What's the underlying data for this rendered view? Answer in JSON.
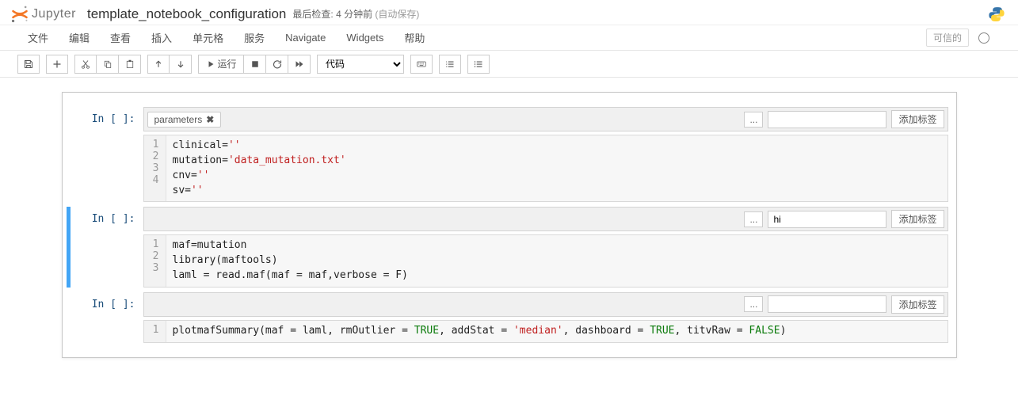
{
  "header": {
    "logo_text": "Jupyter",
    "notebook_name": "template_notebook_configuration",
    "checkpoint_label": "最后检查:",
    "checkpoint_value": "4 分钟前",
    "autosave": "(自动保存)"
  },
  "menubar": {
    "items": [
      "文件",
      "编辑",
      "查看",
      "插入",
      "单元格",
      "服务",
      "Navigate",
      "Widgets",
      "帮助"
    ],
    "trusted": "可信的"
  },
  "toolbar": {
    "run_label": "运行",
    "celltype_value": "代码"
  },
  "tags": {
    "ellipsis": "...",
    "add_button": "添加标签"
  },
  "cells": [
    {
      "prompt": "In [ ]:",
      "tag": "parameters",
      "tag_input": "",
      "lines": [
        {
          "n": "1",
          "pre": "clinical=",
          "str": "''",
          "post": ""
        },
        {
          "n": "2",
          "pre": "mutation=",
          "str": "'data_mutation.txt'",
          "post": ""
        },
        {
          "n": "3",
          "pre": "cnv=",
          "str": "''",
          "post": ""
        },
        {
          "n": "4",
          "pre": "sv=",
          "str": "''",
          "post": ""
        }
      ]
    },
    {
      "prompt": "In [ ]:",
      "tag_input": "hi",
      "lines": [
        {
          "n": "1",
          "pre": "maf=mutation",
          "str": "",
          "post": ""
        },
        {
          "n": "2",
          "pre": "library(maftools)",
          "str": "",
          "post": ""
        },
        {
          "n": "3",
          "pre": "laml = read.maf(maf = maf,verbose = F)",
          "str": "",
          "post": ""
        }
      ]
    },
    {
      "prompt": "In [ ]:",
      "tag_input": "",
      "lines": [
        {
          "n": "1",
          "pre": "plotmafSummary(maf = laml, rmOutlier = ",
          "bool1": "TRUE",
          "mid1": ", addStat = ",
          "str": "'median'",
          "mid2": ", dashboard = ",
          "bool2": "TRUE",
          "mid3": ", titvRaw = ",
          "bool3": "FALSE",
          "post": ")"
        }
      ]
    }
  ]
}
